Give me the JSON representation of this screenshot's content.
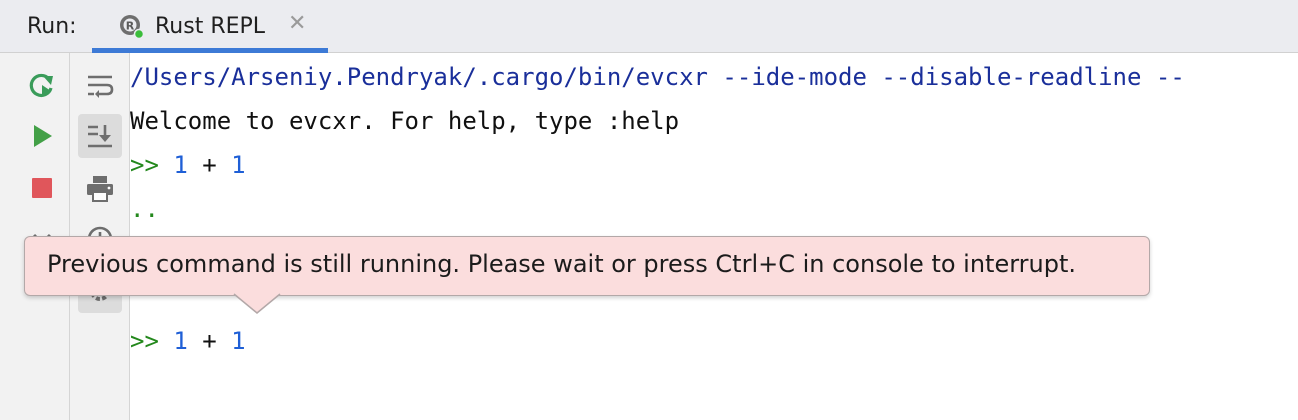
{
  "run_bar": {
    "label": "Run:",
    "tab": {
      "title": "Rust REPL",
      "close_glyph": "✕",
      "icon": "rust-repl-icon"
    }
  },
  "left_toolbar": {
    "buttons": [
      {
        "name": "rerun-icon",
        "color": "#3a9c5a"
      },
      {
        "name": "run-icon",
        "color": "#43a047"
      },
      {
        "name": "stop-icon",
        "color": "#e0565b"
      },
      {
        "name": "close-icon",
        "color": "#6e6e6e"
      }
    ]
  },
  "second_toolbar": {
    "buttons": [
      {
        "name": "soft-wrap-icon"
      },
      {
        "name": "scroll-to-end-icon",
        "selected": true
      },
      {
        "name": "print-icon"
      },
      {
        "name": "history-icon"
      },
      {
        "name": "settings-icon"
      }
    ]
  },
  "console": {
    "command_line": "/Users/Arseniy.Pendryak/.cargo/bin/evcxr --ide-mode --disable-readline --",
    "welcome": "Welcome to evcxr. For help, type :help",
    "entries": [
      {
        "prompt": ">>",
        "lhs": "1",
        "op": "+",
        "rhs": "1"
      },
      {
        "prompt": ">>",
        "lhs": "1",
        "op": "+",
        "rhs": "1"
      }
    ],
    "continuation": ".."
  },
  "tooltip": {
    "message": "Previous command is still running. Please wait or press Ctrl+C in console to interrupt."
  },
  "colors": {
    "accent": "#3d7ad6",
    "prompt": "#23881c",
    "number": "#1f5fd6",
    "path": "#1a2f9a",
    "tooltip_bg": "#fbdddd"
  }
}
